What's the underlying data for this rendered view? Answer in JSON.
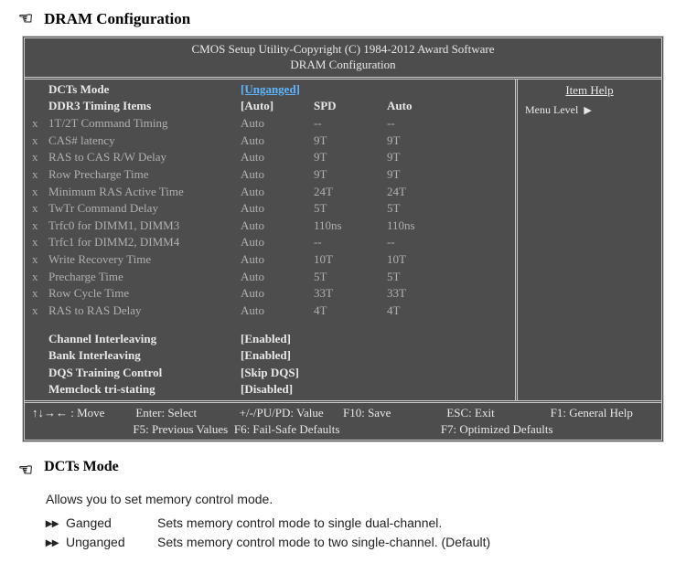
{
  "section_title": "DRAM Configuration",
  "bios_header_line1": "CMOS Setup Utility-Copyright (C) 1984-2012 Award Software",
  "bios_header_line2": "DRAM Configuration",
  "columns": {
    "mode_label": "DCTs Mode",
    "mode_value": "[Unganged]",
    "timing_label": "DDR3 Timing Items",
    "auto": "[Auto]",
    "spd": "SPD",
    "auto2": "Auto"
  },
  "rows": [
    {
      "label": "1T/2T Command Timing",
      "c1": "Auto",
      "c2": "--",
      "c3": "--"
    },
    {
      "label": "CAS# latency",
      "c1": "Auto",
      "c2": "9T",
      "c3": "9T"
    },
    {
      "label": "RAS to CAS R/W Delay",
      "c1": "Auto",
      "c2": "9T",
      "c3": "9T"
    },
    {
      "label": "Row Precharge Time",
      "c1": "Auto",
      "c2": "9T",
      "c3": "9T"
    },
    {
      "label": "Minimum RAS Active Time",
      "c1": "Auto",
      "c2": "24T",
      "c3": "24T"
    },
    {
      "label": "TwTr Command Delay",
      "c1": "Auto",
      "c2": "5T",
      "c3": "5T"
    },
    {
      "label": "Trfc0 for DIMM1, DIMM3",
      "c1": "Auto",
      "c2": "110ns",
      "c3": "110ns"
    },
    {
      "label": "Trfc1 for DIMM2, DIMM4",
      "c1": "Auto",
      "c2": "--",
      "c3": "--"
    },
    {
      "label": "Write Recovery Time",
      "c1": "Auto",
      "c2": "10T",
      "c3": "10T"
    },
    {
      "label": "Precharge Time",
      "c1": "Auto",
      "c2": "5T",
      "c3": "5T"
    },
    {
      "label": "Row Cycle Time",
      "c1": "Auto",
      "c2": "33T",
      "c3": "33T"
    },
    {
      "label": "RAS to RAS Delay",
      "c1": "Auto",
      "c2": "4T",
      "c3": "4T"
    }
  ],
  "bottom_rows": [
    {
      "label": "Channel Interleaving",
      "value": "[Enabled]"
    },
    {
      "label": "Bank Interleaving",
      "value": "[Enabled]"
    },
    {
      "label": "DQS Training Control",
      "value": "[Skip DQS]"
    },
    {
      "label": "Memclock tri-stating",
      "value": "[Disabled]"
    }
  ],
  "help": {
    "title": "Item Help",
    "menu_level": "Menu Level"
  },
  "footer": {
    "move": "↑↓→← : Move",
    "enter": "Enter: Select",
    "pupd": "+/-/PU/PD: Value",
    "f10": "F10: Save",
    "esc": "ESC: Exit",
    "f1": "F1: General Help",
    "f5": "F5: Previous Values",
    "f6": "F6: Fail-Safe Defaults",
    "f7": "F7: Optimized Defaults"
  },
  "doc": {
    "subhead": "DCTs Mode",
    "desc": "Allows you to set memory control mode.",
    "options": [
      {
        "name": "Ganged",
        "desc": "Sets memory control mode to single dual-channel."
      },
      {
        "name": "Unganged",
        "desc": "Sets memory control mode to two single-channel. (Default)"
      }
    ]
  }
}
